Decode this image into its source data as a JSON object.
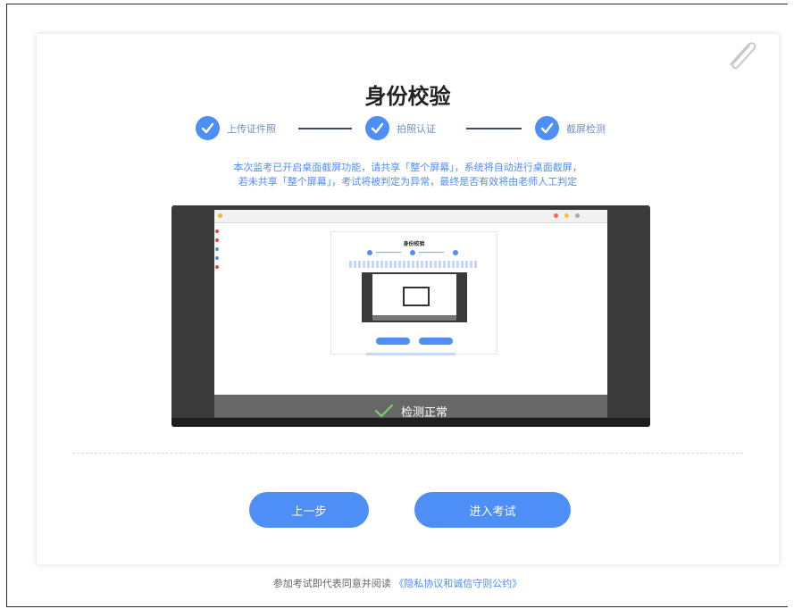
{
  "page": {
    "title": "身份校验",
    "steps": [
      {
        "label": "上传证件照"
      },
      {
        "label": "拍照认证"
      },
      {
        "label": "截屏检测"
      }
    ],
    "notice_line1": "本次监考已开启桌面截屏功能，请共享「整个屏幕」，系统将自动进行桌面截屏，",
    "notice_line2": "若未共享「整个屏幕」，考试将被判定为异常，最终是否有效将由老师人工判定",
    "preview": {
      "mini_title": "身份校验",
      "status_text": "检测正常"
    },
    "buttons": {
      "prev_label": "上一步",
      "enter_label": "进入考试"
    },
    "footer": {
      "prefix": "参加考试即代表同意并阅读",
      "link_text": "《隐私协议和诚信守则公约》"
    }
  },
  "colors": {
    "accent": "#4d8ef7",
    "step_line": "#3e4d66",
    "preview_bg": "#3a3a3a",
    "status_overlay": "#5a5a5a"
  },
  "icons": {
    "clip": "paperclip-icon",
    "step_check": "check-circle-icon",
    "status_check": "check-icon"
  }
}
